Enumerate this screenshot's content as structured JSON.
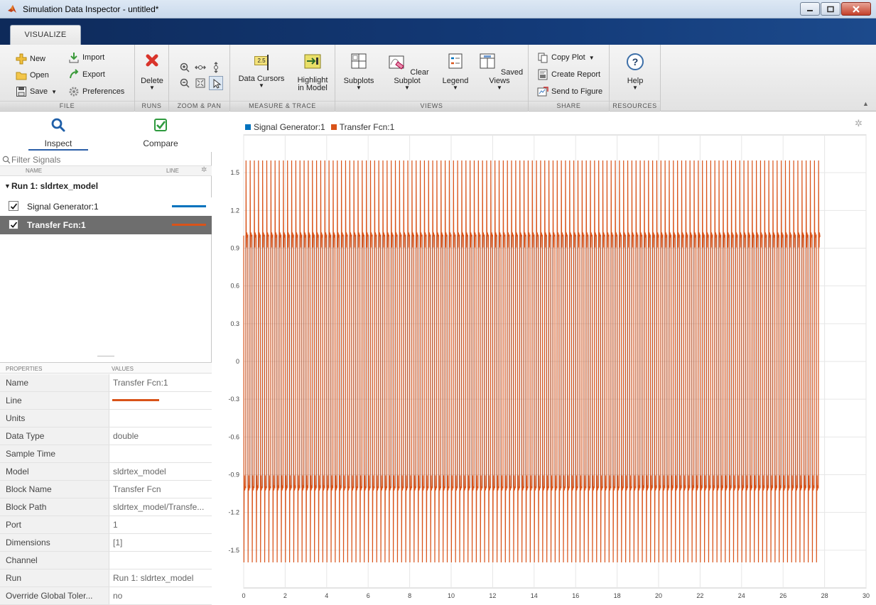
{
  "window": {
    "title": "Simulation Data Inspector - untitled*"
  },
  "tabs": {
    "visualize": "VISUALIZE"
  },
  "toolstrip": {
    "file": {
      "label": "FILE",
      "new": "New",
      "open": "Open",
      "save": "Save",
      "import": "Import",
      "export": "Export",
      "preferences": "Preferences"
    },
    "runs": {
      "label": "RUNS",
      "delete": "Delete"
    },
    "zoom_pan": {
      "label": "ZOOM & PAN"
    },
    "measure_trace": {
      "label": "MEASURE & TRACE",
      "data_cursors": "Data Cursors",
      "cursor_badge": "2.5",
      "highlight_line1": "Highlight",
      "highlight_line2": "in Model"
    },
    "views": {
      "label": "VIEWS",
      "subplots": "Subplots",
      "clear_subplot": "Clear Subplot",
      "legend": "Legend",
      "saved_views": "Saved Views"
    },
    "share": {
      "label": "SHARE",
      "copy_plot": "Copy Plot",
      "create_report": "Create Report",
      "send_to_figure": "Send to Figure"
    },
    "resources": {
      "label": "RESOURCES",
      "help": "Help"
    }
  },
  "left_panel": {
    "inspect_tab": "Inspect",
    "compare_tab": "Compare",
    "filter_placeholder": "Filter Signals",
    "col_name": "NAME",
    "col_line": "LINE",
    "run_label": "Run 1: sldrtex_model",
    "signals": [
      {
        "name": "Signal Generator:1",
        "checked": true,
        "color": "#0072BD",
        "selected": false
      },
      {
        "name": "Transfer Fcn:1",
        "checked": true,
        "color": "#D95319",
        "selected": true
      }
    ]
  },
  "properties": {
    "col_properties": "PROPERTIES",
    "col_values": "VALUES",
    "rows": [
      {
        "name": "Name",
        "value": "Transfer Fcn:1"
      },
      {
        "name": "Line",
        "value": ""
      },
      {
        "name": "Units",
        "value": ""
      },
      {
        "name": "Data Type",
        "value": "double"
      },
      {
        "name": "Sample Time",
        "value": ""
      },
      {
        "name": "Model",
        "value": "sldrtex_model"
      },
      {
        "name": "Block Name",
        "value": "Transfer Fcn"
      },
      {
        "name": "Block Path",
        "value": "sldrtex_model/Transfe..."
      },
      {
        "name": "Port",
        "value": "1"
      },
      {
        "name": "Dimensions",
        "value": "[1]"
      },
      {
        "name": "Channel",
        "value": ""
      },
      {
        "name": "Run",
        "value": "Run 1: sldrtex_model"
      },
      {
        "name": "Override Global Toler...",
        "value": "no"
      }
    ],
    "line_color": "#D95319"
  },
  "chart_data": {
    "type": "line",
    "title": "",
    "xlabel": "",
    "ylabel": "",
    "xlim": [
      0,
      30
    ],
    "ylim": [
      -1.8,
      1.8
    ],
    "x_ticks": [
      0,
      2,
      4,
      6,
      8,
      10,
      12,
      14,
      16,
      18,
      20,
      22,
      24,
      26,
      28,
      30
    ],
    "y_ticks": [
      1.5,
      1.2,
      0.9,
      0.6,
      0.3,
      0,
      -0.3,
      -0.6,
      -0.9,
      -1.2,
      -1.5
    ],
    "y_tick_labels": [
      "1.5",
      "1.2",
      "0.9",
      "0.6",
      "0.3",
      "0",
      "-0.3",
      "-0.6",
      "-0.9",
      "-1.2",
      "-1.5"
    ],
    "grid": true,
    "legend_position": "top-left",
    "series": [
      {
        "name": "Signal Generator:1",
        "color": "#0072BD",
        "kind": "square wave",
        "amplitude": 1.0,
        "period": 0.2,
        "x_end": 27.7
      },
      {
        "name": "Transfer Fcn:1",
        "color": "#D95319",
        "kind": "underdamped step response",
        "peak": 1.62,
        "steady": 1.0,
        "period": 0.2,
        "x_end": 27.8
      }
    ]
  }
}
